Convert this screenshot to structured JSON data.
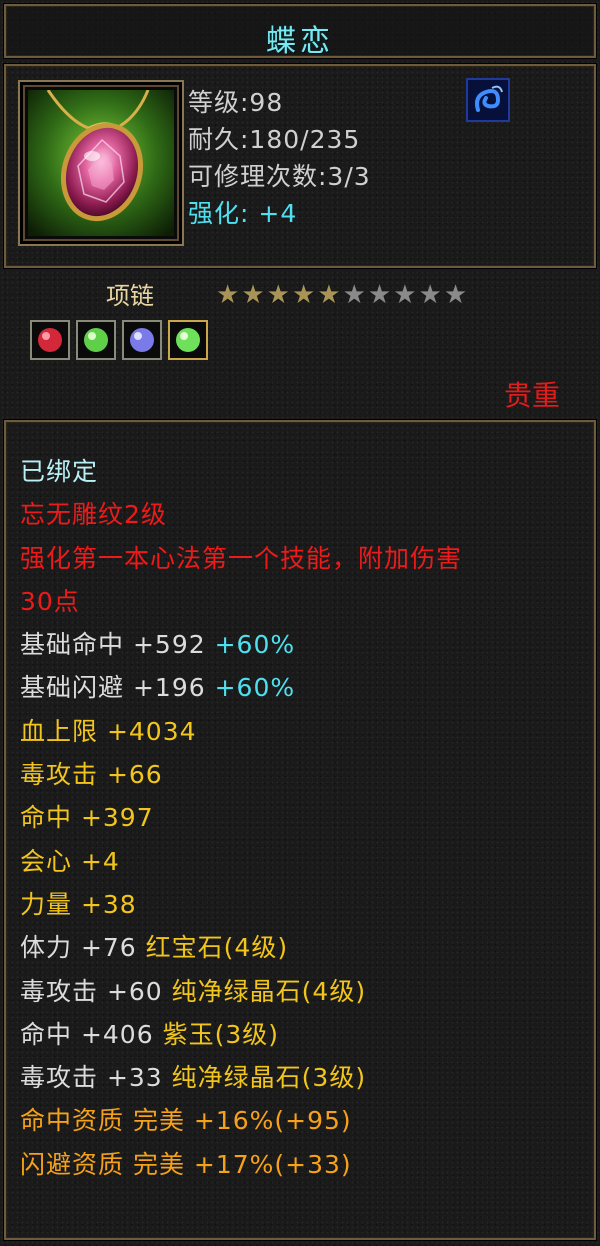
{
  "title": "蝶恋",
  "level": "等级:98",
  "durability": "耐久:180/235",
  "repairs": "可修理次数:3/3",
  "enhance_label": "强化:",
  "enhance_value": "+4",
  "item_type": "项链",
  "stars": {
    "filled": 5,
    "total": 10
  },
  "rarity": "贵重",
  "icon": "pink-gem-necklace-icon",
  "rune_icon": "blue-swirl-rune-icon",
  "gem_slots": [
    {
      "icon": "red-gem-icon",
      "color": "#d2283a"
    },
    {
      "icon": "green-gem-icon",
      "color": "#5fcf4a"
    },
    {
      "icon": "purple-gem-icon",
      "color": "#7a7ae8"
    },
    {
      "icon": "green-gem-icon",
      "color": "#6ee05a"
    }
  ],
  "bound": "已绑定",
  "engrave": "忘无雕纹2级",
  "engrave_desc_1": "强化第一本心法第一个技能，附加伤害",
  "engrave_desc_2": "30点",
  "base_attrs": [
    {
      "label": "基础命中",
      "value": "+592",
      "bonus": "+60%"
    },
    {
      "label": "基础闪避",
      "value": "+196",
      "bonus": "+60%"
    }
  ],
  "attrs": [
    "血上限 +4034",
    "毒攻击 +66",
    "命中 +397",
    "会心 +4",
    "力量 +38"
  ],
  "gem_attrs": [
    {
      "stat": "体力 +76",
      "gem": "红宝石(4级)"
    },
    {
      "stat": "毒攻击 +60",
      "gem": "纯净绿晶石(4级)"
    },
    {
      "stat": "命中 +406",
      "gem": "紫玉(3级)"
    },
    {
      "stat": "毒攻击 +33",
      "gem": "纯净绿晶石(3级)"
    }
  ],
  "qualities": [
    "命中资质  完美 +16%(+95)",
    "闪避资质  完美 +17%(+33)"
  ]
}
